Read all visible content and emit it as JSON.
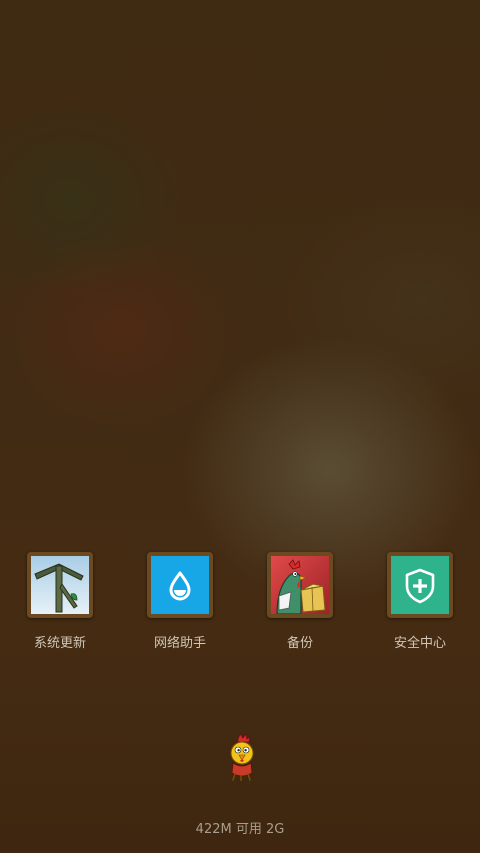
{
  "home_screen": {
    "apps": [
      {
        "label": "系统更新",
        "icon": "system-update-icon"
      },
      {
        "label": "网络助手",
        "icon": "network-assistant-icon"
      },
      {
        "label": "备份",
        "icon": "backup-icon"
      },
      {
        "label": "安全中心",
        "icon": "security-center-icon"
      }
    ],
    "mascot_icon": "rooster-mascot-icon",
    "memory_status": "422M 可用 2G"
  },
  "colors": {
    "tile_frame": "#6b4a22",
    "network_blue": "#17a6e6",
    "security_green": "#2fb38c",
    "backup_red": "#c8383b",
    "label_text": "#cfc6b8",
    "background": "#412b14"
  }
}
